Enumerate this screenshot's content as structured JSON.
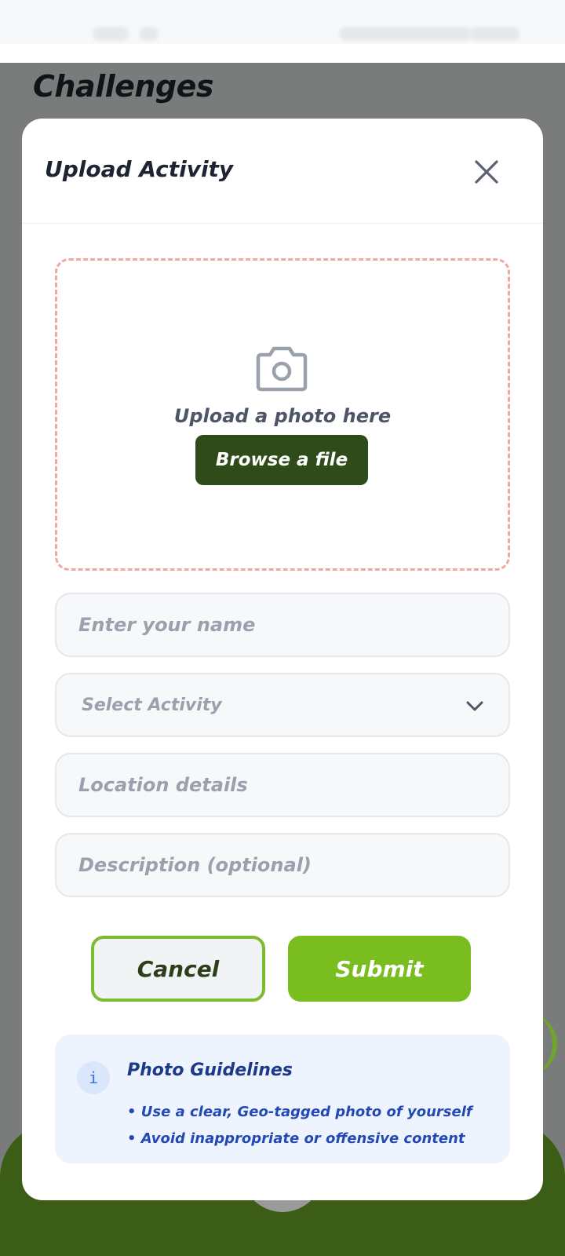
{
  "page": {
    "title": "Challenges"
  },
  "dialog": {
    "title": "Upload Activity",
    "upload": {
      "prompt": "Upload a photo here",
      "browse_label": "Browse a file"
    },
    "fields": {
      "name_placeholder": "Enter your name",
      "activity_placeholder": "Select Activity",
      "location_placeholder": "Location details",
      "description_placeholder": "Description (optional)"
    },
    "actions": {
      "cancel_label": "Cancel",
      "submit_label": "Submit"
    },
    "guidelines": {
      "info_glyph": "i",
      "title": "Photo Guidelines",
      "items": [
        "• Use a clear, Geo-tagged photo of yourself",
        "• Avoid inappropriate or offensive content"
      ]
    }
  },
  "colors": {
    "brand_dark_green": "#2f4b1a",
    "brand_green": "#7abd1f",
    "dashed_border": "#f0a8a2",
    "info_bg": "#edf4fe",
    "info_text": "#2449b5"
  },
  "icons": [
    "close-icon",
    "camera-icon",
    "chevron-down-icon",
    "info-icon"
  ]
}
